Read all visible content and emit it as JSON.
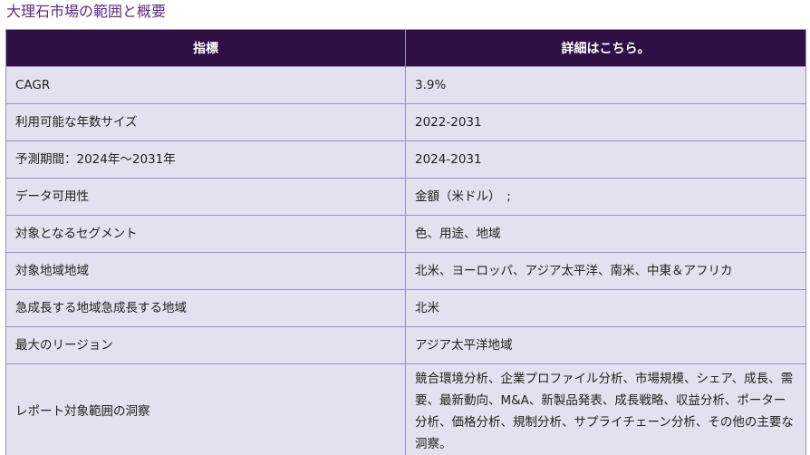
{
  "title": "大理石市場の範囲と概要",
  "table": {
    "headers": [
      "指標",
      "詳細はこちら。"
    ],
    "rows": [
      {
        "label": "CAGR",
        "value": "3.9%"
      },
      {
        "label": "利用可能な年数サイズ",
        "value": "2022-2031"
      },
      {
        "label": "予測期間：2024年～2031年",
        "value": "2024-2031"
      },
      {
        "label": "データ可用性",
        "value": "金額（米ドル）　;"
      },
      {
        "label": "対象となるセグメント",
        "value": "色、用途、地域"
      },
      {
        "label": "対象地域地域",
        "value": "北米、ヨーロッパ、アジア太平洋、南米、中東＆アフリカ"
      },
      {
        "label": "急成長する地域急成長する地域",
        "value": "北米"
      },
      {
        "label": "最大のリージョン",
        "value": "アジア太平洋地域"
      },
      {
        "label": "レポート対象範囲の洞察",
        "value": "競合環境分析、企業プロファイル分析、市場規模、シェア、成長、需要、最新動向、M&A、新製品発表、成長戦略、収益分析、ポーター分析、価格分析、規制分析、サプライチェーン分析、その他の主要な洞察。"
      }
    ]
  }
}
